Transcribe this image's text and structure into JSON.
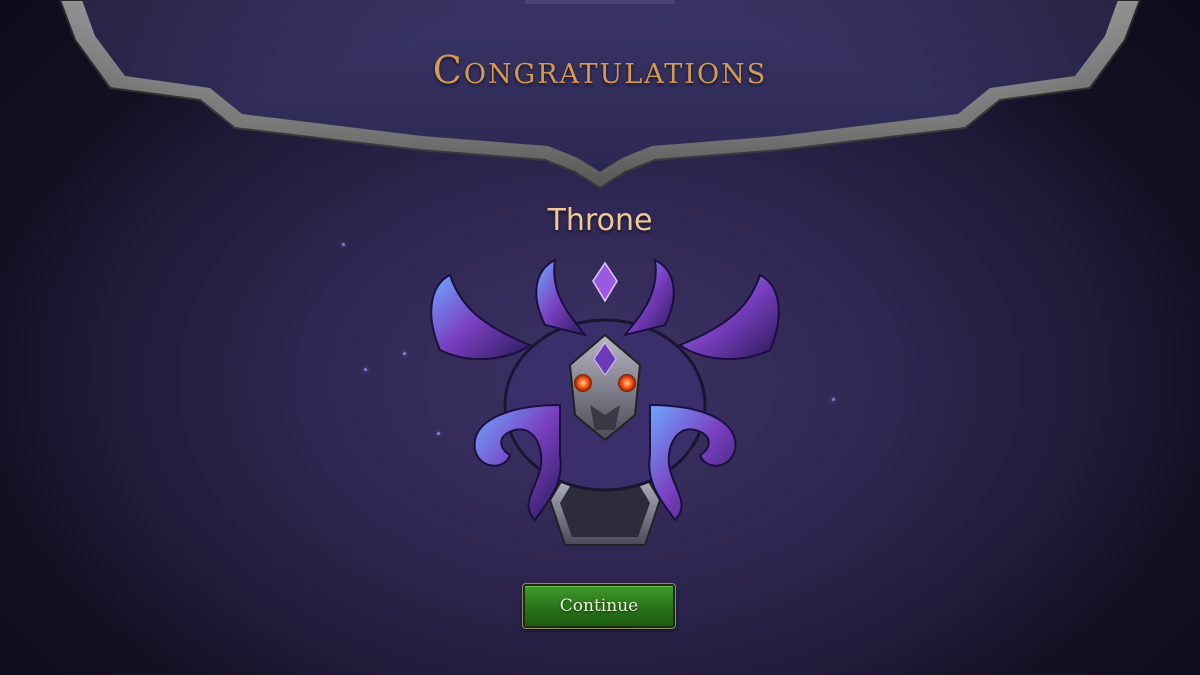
{
  "header": {
    "title": "Congratulations"
  },
  "reward": {
    "name": "Throne",
    "icon": "throne-card-back-icon"
  },
  "actions": {
    "continue_label": "Continue"
  },
  "colors": {
    "title": "#d39a55",
    "reward_name": "#f0c898",
    "button_green": "#2c7a1e",
    "background": "#2f2752"
  }
}
